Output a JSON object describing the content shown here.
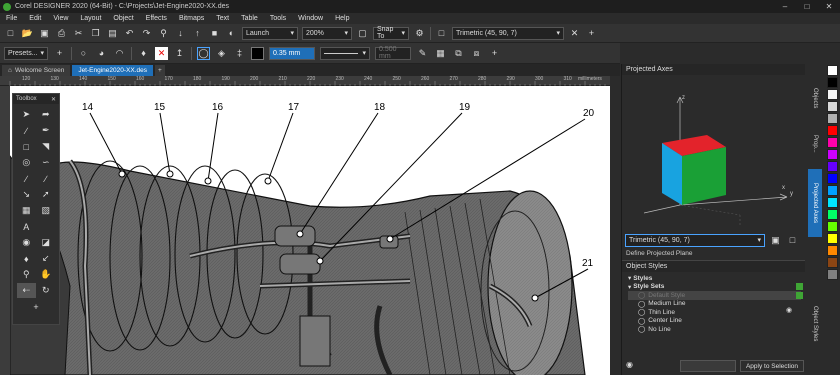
{
  "window": {
    "title": "Corel DESIGNER 2020 (64-Bit) - C:\\Projects\\Jet-Engine2020-XX.des",
    "controls": [
      "minimize-icon",
      "maximize-icon",
      "close-icon"
    ]
  },
  "menu": [
    "File",
    "Edit",
    "View",
    "Layout",
    "Object",
    "Effects",
    "Bitmaps",
    "Text",
    "Table",
    "Tools",
    "Window",
    "Help"
  ],
  "toolbar": {
    "launch_label": "Launch",
    "zoom": "200%",
    "snap_to": "Snap To",
    "projection": "Trimetric (45, 90, 7)"
  },
  "propertybar": {
    "presets": "Presets...",
    "stroke_width": "0.35 mm",
    "dim_value": "0.500 mm"
  },
  "tabs": [
    "Welcome Screen",
    "Jet-Engine2020-XX.des"
  ],
  "ruler_marks": [
    "120",
    "130",
    "140",
    "150",
    "160",
    "170",
    "180",
    "190",
    "200",
    "210",
    "220",
    "230",
    "240",
    "250",
    "260",
    "270",
    "280",
    "290",
    "300",
    "310",
    "millimeters"
  ],
  "toolbox_title": "Toolbox",
  "callouts": [
    "14",
    "15",
    "16",
    "17",
    "18",
    "19",
    "20",
    "21"
  ],
  "projected_axes": {
    "title": "Projected Axes",
    "axis_labels": [
      "z",
      "y",
      "x"
    ],
    "selection": "Trimetric (45, 90, 7)",
    "define_label": "Define Projected Plane",
    "cube_colors": {
      "top": "#e3232b",
      "left": "#18a3e0",
      "right": "#1aa036"
    }
  },
  "object_styles": {
    "title": "Object Styles",
    "items": [
      "Styles",
      "Style Sets",
      "Default Style",
      "Medium Line",
      "Thin Line",
      "Center Line",
      "No Line"
    ],
    "apply_label": "Apply to Selection"
  },
  "side_tabs": [
    "Objects",
    "Prop...",
    "Projected Axes",
    "Object Styles"
  ],
  "palette_colors": [
    "#ffffff",
    "#000000",
    "#f5f5f5",
    "#d9d9d9",
    "#b0b0b0",
    "#ff0000",
    "#ff00aa",
    "#cc00ff",
    "#6600ff",
    "#0000ff",
    "#00a0ff",
    "#00e5ff",
    "#00ff66",
    "#66ff00",
    "#ffff00",
    "#ff8800",
    "#8b4513",
    "#808080"
  ]
}
